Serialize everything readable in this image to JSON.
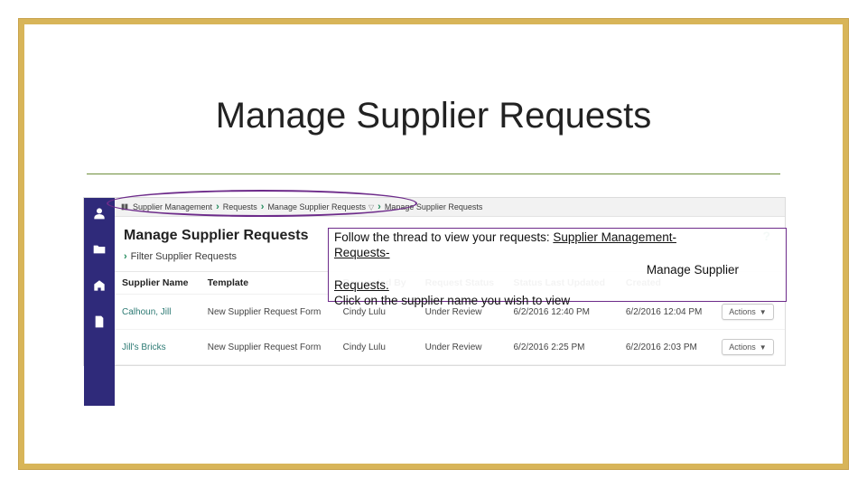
{
  "slide": {
    "title": "Manage Supplier Requests"
  },
  "breadcrumb": {
    "items": [
      {
        "label": "Supplier Management"
      },
      {
        "label": "Requests"
      },
      {
        "label": "Manage Supplier Requests"
      },
      {
        "label": "Manage Supplier Requests"
      }
    ]
  },
  "page": {
    "heading": "Manage Supplier Requests",
    "help_glyph": "?",
    "filter_label": "Filter Supplier Requests"
  },
  "table": {
    "headers": [
      "Supplier Name",
      "Template",
      "Requested By",
      "Request Status",
      "Status Last Updated",
      "Created",
      ""
    ],
    "rows": [
      {
        "supplier": "Calhoun, Jill",
        "template": "New Supplier Request Form",
        "requested_by": "Cindy Lulu",
        "status": "Under Review",
        "status_updated": "6/2/2016 12:40 PM",
        "created": "6/2/2016 12:04 PM",
        "actions_label": "Actions"
      },
      {
        "supplier": "Jill's Bricks",
        "template": "New Supplier Request Form",
        "requested_by": "Cindy Lulu",
        "status": "Under Review",
        "status_updated": "6/2/2016 2:25 PM",
        "created": "6/2/2016 2:03 PM",
        "actions_label": "Actions"
      }
    ]
  },
  "callout": {
    "line1_pre": "Follow the thread to view your requests: ",
    "line1_link": "Supplier Management-",
    "line2_link": "Requests-",
    "line_ms": "Manage Supplier",
    "line3_link": "Requests.",
    "line4": "Click on the supplier name you wish to view"
  },
  "icons": {
    "nav_person": "person-icon",
    "nav_folder": "folder-icon",
    "nav_building": "building-icon",
    "nav_paper": "paper-icon"
  }
}
